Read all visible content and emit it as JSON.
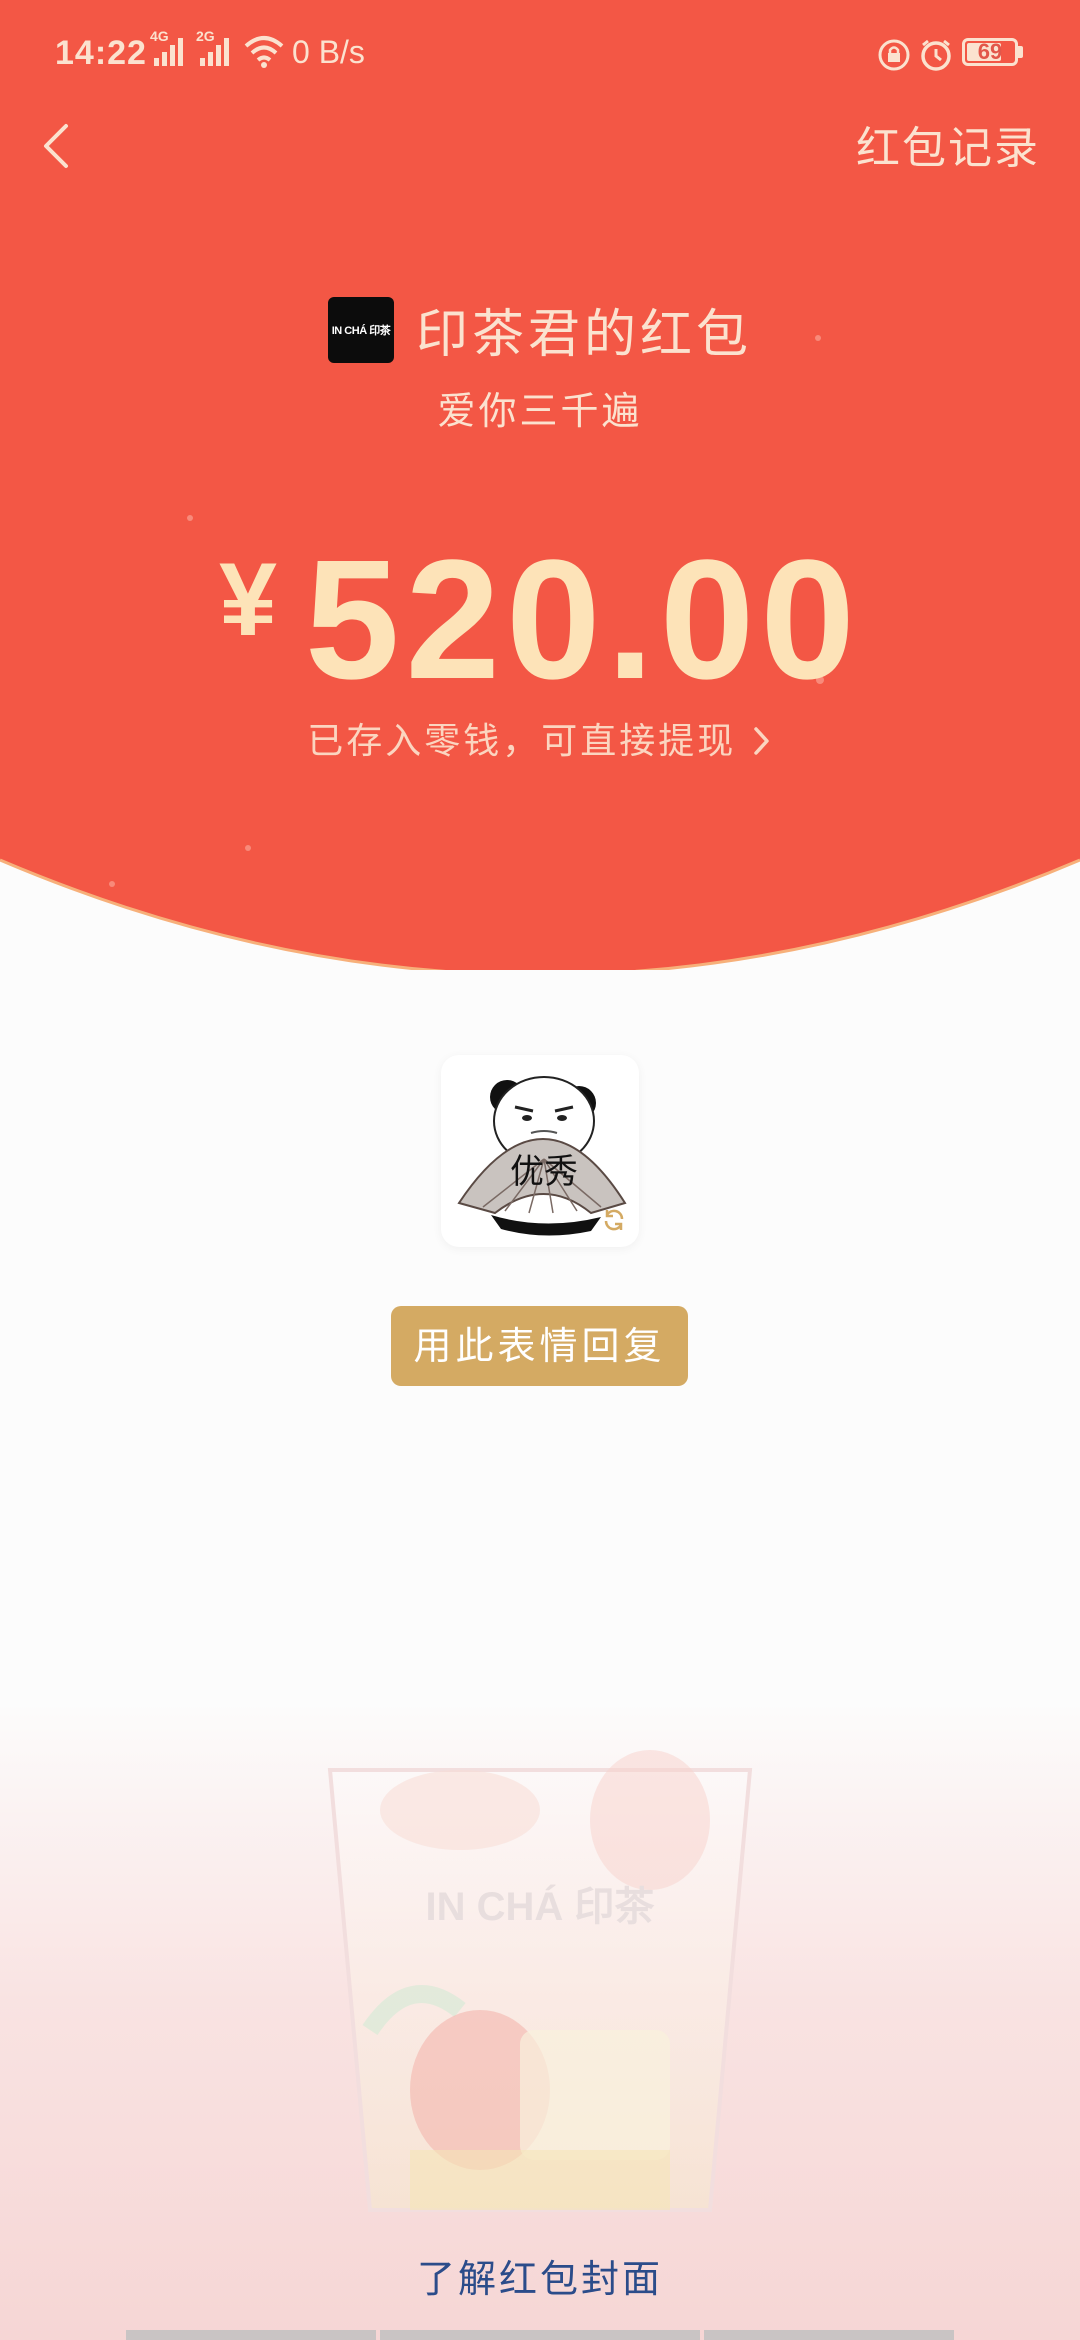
{
  "status_bar": {
    "time": "14:22",
    "network_1": "4G",
    "network_2": "2G",
    "net_speed": "0 B/s",
    "battery_level": "69",
    "icons": [
      "signal-icon",
      "wifi-icon",
      "lock-rotation-icon",
      "alarm-icon",
      "battery-icon"
    ]
  },
  "header": {
    "back_icon": "chevron-left-icon",
    "record_label": "红包记录"
  },
  "sender": {
    "logo_text": "IN CHÁ 印茶",
    "name": "印茶君的红包",
    "greeting": "爱你三千遍"
  },
  "amount": {
    "currency": "¥",
    "value": "520.00",
    "hint": "已存入零钱，可直接提现",
    "hint_icon": "chevron-right-icon"
  },
  "sticker": {
    "name": "panda-fan-sticker",
    "fan_text": "优秀",
    "refresh_icon": "refresh-icon"
  },
  "reply_button": {
    "label": "用此表情回复"
  },
  "cover": {
    "cup_brand": "IN CHÁ 印茶",
    "link_label": "了解红包封面"
  },
  "colors": {
    "red": "#f35745",
    "cream": "#fbe2cf",
    "amount": "#fde3b8",
    "gold_button": "#d4aa63",
    "link_blue": "#2b4c8a"
  }
}
